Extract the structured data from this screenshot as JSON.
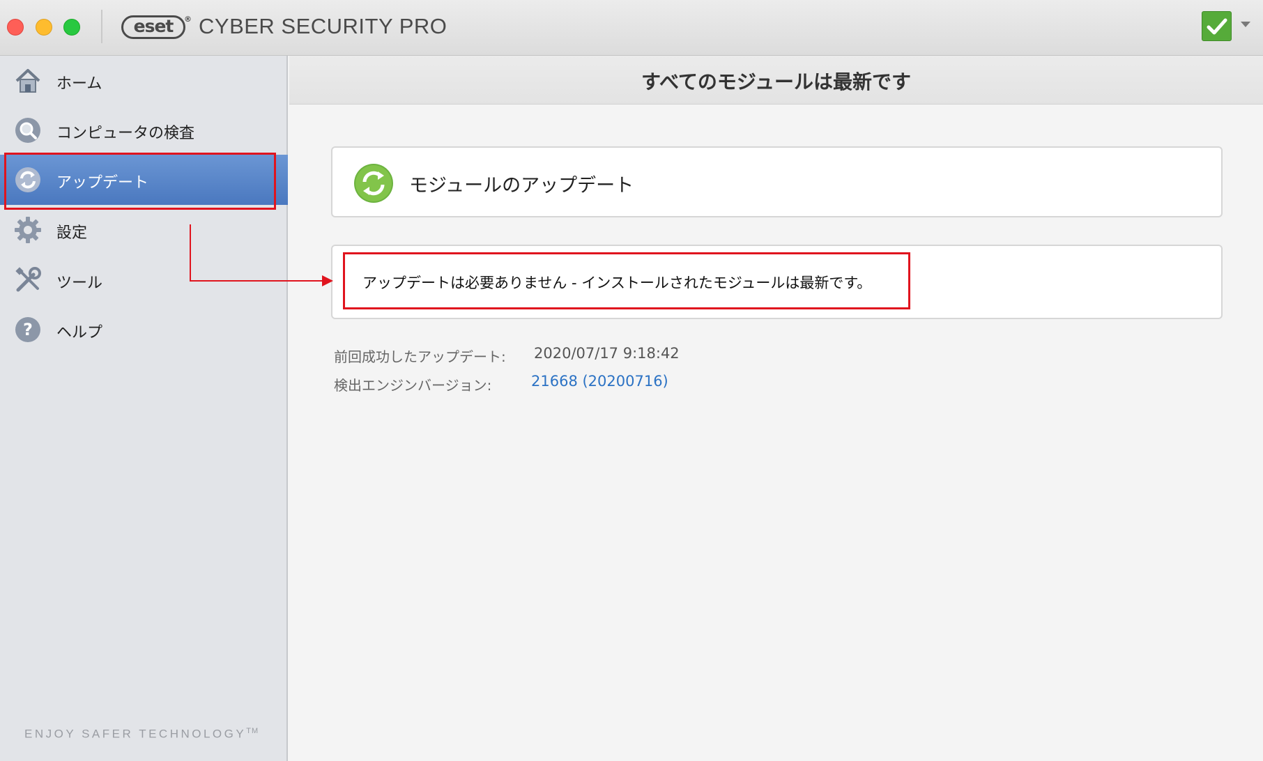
{
  "window": {
    "logo_text": "eset",
    "logo_reg": "®",
    "app_title": "CYBER SECURITY PRO"
  },
  "sidebar": {
    "items": [
      {
        "label": "ホーム",
        "icon": "home-icon"
      },
      {
        "label": "コンピュータの検査",
        "icon": "magnifier-icon"
      },
      {
        "label": "アップデート",
        "icon": "update-arrows-icon",
        "active": true
      },
      {
        "label": "設定",
        "icon": "gear-icon"
      },
      {
        "label": "ツール",
        "icon": "tools-icon"
      },
      {
        "label": "ヘルプ",
        "icon": "help-icon"
      }
    ],
    "tagline": "ENJOY SAFER TECHNOLOGY",
    "tagline_tm": "TM"
  },
  "main": {
    "header_title": "すべてのモジュールは最新です",
    "module_card_title": "モジュールのアップデート",
    "message": "アップデートは必要ありません - インストールされたモジュールは最新です。",
    "last_update_label": "前回成功したアップデート:",
    "last_update_value": "2020/07/17 9:18:42",
    "engine_label": "検出エンジンバージョン:",
    "engine_value": "21668 (20200716)"
  },
  "colors": {
    "active_nav": "#4a78bf",
    "status_ok": "#56ab3a",
    "link": "#2b72c4",
    "annotation": "#e0141e"
  }
}
